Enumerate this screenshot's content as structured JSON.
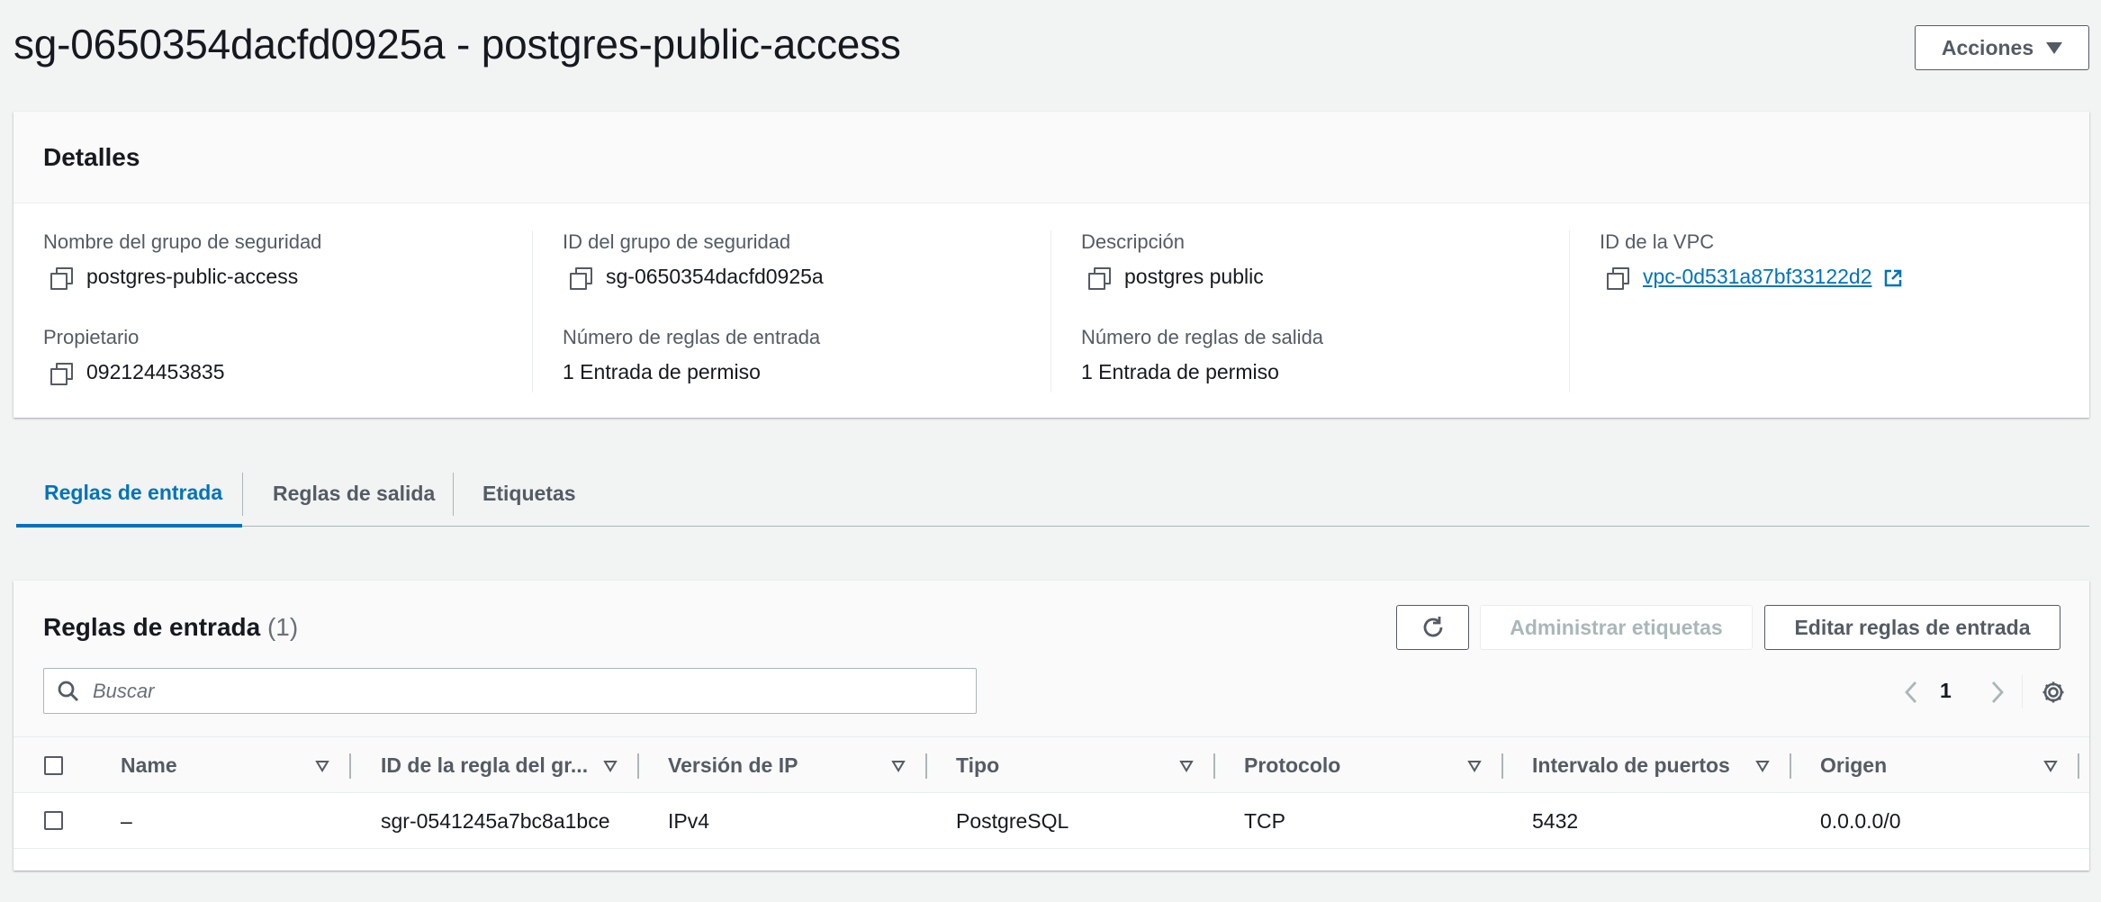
{
  "page": {
    "title": "sg-0650354dacfd0925a - postgres-public-access",
    "actions_label": "Acciones"
  },
  "details": {
    "title": "Detalles",
    "fields": {
      "sg_name": {
        "label": "Nombre del grupo de seguridad",
        "value": "postgres-public-access"
      },
      "sg_id": {
        "label": "ID del grupo de seguridad",
        "value": "sg-0650354dacfd0925a"
      },
      "description": {
        "label": "Descripción",
        "value": "postgres public"
      },
      "vpc_id": {
        "label": "ID de la VPC",
        "value": "vpc-0d531a87bf33122d2"
      },
      "owner": {
        "label": "Propietario",
        "value": "092124453835"
      },
      "inbound_count": {
        "label": "Número de reglas de entrada",
        "value": "1 Entrada de permiso"
      },
      "outbound_count": {
        "label": "Número de reglas de salida",
        "value": "1 Entrada de permiso"
      }
    }
  },
  "tabs": [
    {
      "label": "Reglas de entrada",
      "active": true
    },
    {
      "label": "Reglas de salida",
      "active": false
    },
    {
      "label": "Etiquetas",
      "active": false
    }
  ],
  "rules": {
    "title": "Reglas de entrada",
    "count": "(1)",
    "manage_tags_label": "Administrar etiquetas",
    "edit_rules_label": "Editar reglas de entrada",
    "search_placeholder": "Buscar",
    "current_page": "1",
    "columns": [
      "Name",
      "ID de la regla del gr...",
      "Versión de IP",
      "Tipo",
      "Protocolo",
      "Intervalo de puertos",
      "Origen"
    ],
    "rows": [
      [
        "–",
        "sgr-0541245a7bc8a1bce",
        "IPv4",
        "PostgreSQL",
        "TCP",
        "5432",
        "0.0.0.0/0"
      ]
    ]
  },
  "icons": [
    "caret-down-icon",
    "copy-icon",
    "external-link-icon",
    "refresh-icon",
    "search-icon",
    "chevron-left-icon",
    "chevron-right-icon",
    "gear-icon",
    "sort-icon"
  ],
  "colors": {
    "link": "#0073bb",
    "text": "#16191f",
    "muted": "#545b64",
    "background": "#f2f3f3"
  }
}
